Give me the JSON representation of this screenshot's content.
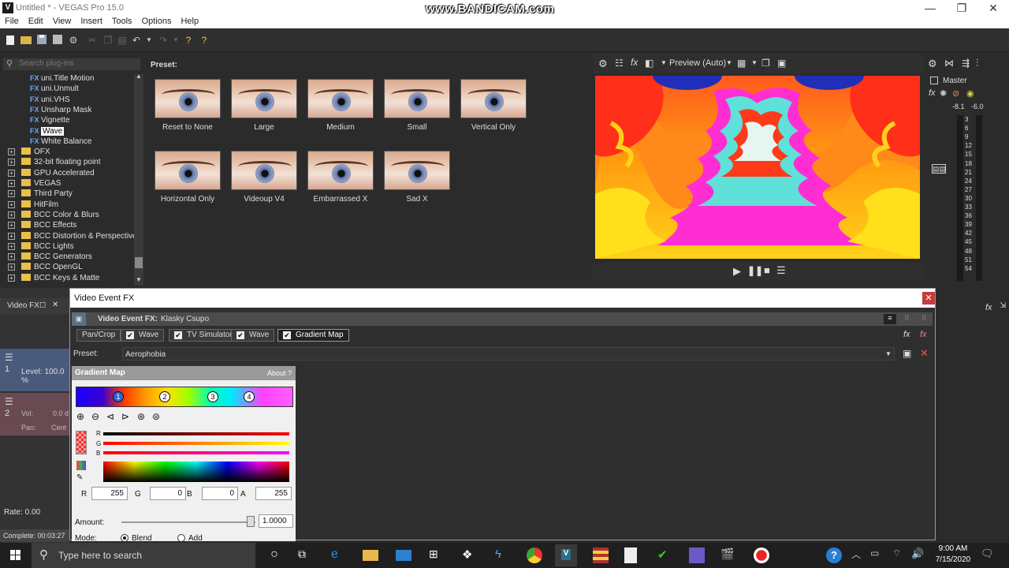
{
  "window": {
    "title": "Untitled * - VEGAS Pro 15.0",
    "app_icon_letter": "V",
    "watermark": "www.BANDICAM.com",
    "minimize": "—",
    "maximize": "❐",
    "close": "✕"
  },
  "menu": [
    "File",
    "Edit",
    "View",
    "Insert",
    "Tools",
    "Options",
    "Help"
  ],
  "plugins": {
    "search_placeholder": "Search plug-ins",
    "fx_items": [
      {
        "label": "uni.Title Motion",
        "selected": false
      },
      {
        "label": "uni.Unmult",
        "selected": false
      },
      {
        "label": "uni.VHS",
        "selected": false
      },
      {
        "label": "Unsharp Mask",
        "selected": false
      },
      {
        "label": "Vignette",
        "selected": false
      },
      {
        "label": "Wave",
        "selected": true
      },
      {
        "label": "White Balance",
        "selected": false
      }
    ],
    "folders": [
      "OFX",
      "32-bit floating point",
      "GPU Accelerated",
      "VEGAS",
      "Third Party",
      "HitFilm",
      "BCC Color & Blurs",
      "BCC Effects",
      "BCC Distortion & Perspective",
      "BCC Lights",
      "BCC Generators",
      "BCC OpenGL",
      "BCC Keys & Matte"
    ],
    "fx_tag": "FX"
  },
  "presets": {
    "header": "Preset:",
    "items": [
      "Reset to None",
      "Large",
      "Medium",
      "Small",
      "Vertical Only",
      "Horizontal Only",
      "Videoup V4",
      "Embarrassed X",
      "Sad X"
    ]
  },
  "preview": {
    "mode": "Preview (Auto)"
  },
  "master": {
    "label": "Master",
    "peak_left": "-8.1",
    "peak_right": "-6.0",
    "scale": [
      "3",
      "6",
      "9",
      "12",
      "15",
      "18",
      "21",
      "24",
      "27",
      "30",
      "33",
      "36",
      "39",
      "42",
      "45",
      "48",
      "51",
      "54"
    ]
  },
  "tracks": {
    "tab_label": "Video FX",
    "track1_level": "Level: 100.0 %",
    "track1_num": "1",
    "track2_num": "2",
    "track2_vol_label": "Vol:",
    "track2_vol_value": "0.0 d",
    "track2_pan_label": "Pan:",
    "track2_pan_value": "Cent",
    "rate": "Rate: 0.00",
    "complete": "Complete: 00:03:27"
  },
  "dialog": {
    "title": "Video Event FX",
    "header_label": "Video Event FX:",
    "event_name": "Klasky Csupo",
    "chain": [
      {
        "label": "Pan/Crop",
        "check": false
      },
      {
        "label": "Wave",
        "check": true
      },
      {
        "label": "TV Simulator",
        "check": true
      },
      {
        "label": "Wave",
        "check": true
      },
      {
        "label": "Gradient Map",
        "check": true
      }
    ],
    "preset_label": "Preset:",
    "preset_value": "Aerophobia",
    "plugin_name": "Gradient Map",
    "about": "About",
    "about_q": "?",
    "stops": [
      "1",
      "2",
      "3",
      "4"
    ],
    "channel_labels": [
      "R",
      "G",
      "B"
    ],
    "rgba": [
      {
        "label": "R",
        "value": "255"
      },
      {
        "label": "G",
        "value": "0"
      },
      {
        "label": "B",
        "value": "0"
      },
      {
        "label": "A",
        "value": "255"
      }
    ],
    "amount_label": "Amount:",
    "amount_value": "1.0000",
    "amount_fraction": 0.98,
    "mode_label": "Mode:",
    "mode_blend": "Blend",
    "mode_add": "Add",
    "close_glyph": "✕"
  },
  "taskbar": {
    "search_placeholder": "Type here to search",
    "time": "9:00 AM",
    "date": "7/15/2020"
  }
}
